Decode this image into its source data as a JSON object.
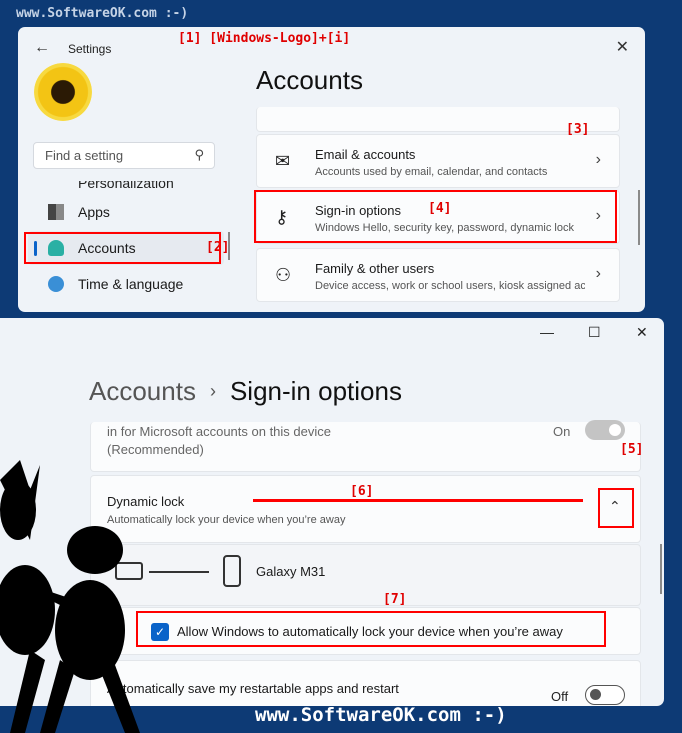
{
  "watermark": "www.SoftwareOK.com :-)",
  "footer_watermark": "www.SoftwareOK.com :-)",
  "window1": {
    "title": "Settings",
    "annotation_1": "[1]  [Windows-Logo]+[i]",
    "search_placeholder": "Find a setting",
    "nav": [
      {
        "label": "Personalization",
        "icon": "brush-icon"
      },
      {
        "label": "Apps",
        "icon": "apps-icon"
      },
      {
        "label": "Accounts",
        "icon": "person-icon",
        "active": true
      },
      {
        "label": "Time & language",
        "icon": "globe-clock-icon"
      }
    ],
    "annotation_2": "[2]",
    "heading": "Accounts",
    "annotation_3": "[3]",
    "annotation_4": "[4]",
    "cards": [
      {
        "title": "Email & accounts",
        "desc": "Accounts used by email, calendar, and contacts",
        "icon": "mail-icon"
      },
      {
        "title": "Sign-in options",
        "desc": "Windows Hello, security key, password, dynamic lock",
        "icon": "key-icon"
      },
      {
        "title": "Family & other users",
        "desc": "Device access, work or school users, kiosk assigned access",
        "icon": "add-user-icon"
      }
    ]
  },
  "window2": {
    "breadcrumb_parent": "Accounts",
    "breadcrumb_sep": "›",
    "breadcrumb_current": "Sign-in options",
    "partial_setting": {
      "line1": "in for Microsoft accounts on this device",
      "line2": "(Recommended)",
      "state": "On"
    },
    "dynamic_lock": {
      "title": "Dynamic lock",
      "desc": "Automatically lock your device when you’re away"
    },
    "device_name": "Galaxy M31",
    "checkbox_label": "Allow Windows to automatically lock your device when you’re away",
    "checkbox_checked": true,
    "restart_apps": {
      "line1": "Automatically save my restartable apps and restart",
      "state": "Off"
    },
    "annotation_5": "[5]",
    "annotation_6": "[6]",
    "annotation_7": "[7]"
  }
}
